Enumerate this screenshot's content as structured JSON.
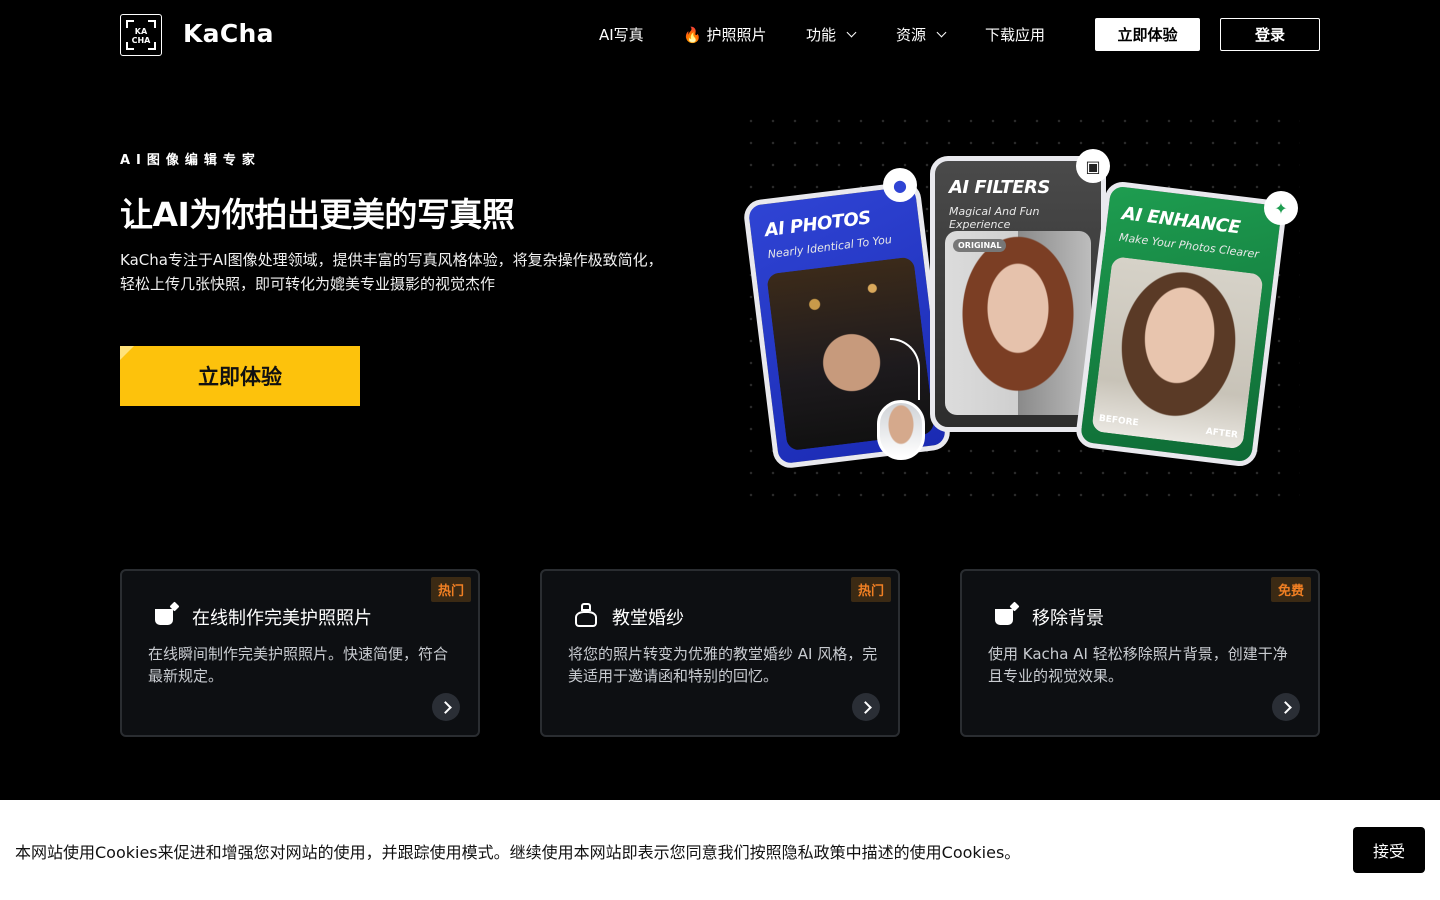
{
  "brand": {
    "logo_mark_line1": "KA",
    "logo_mark_line2": "CHA",
    "name": "KaCha"
  },
  "nav": {
    "items": [
      {
        "label": "AI写真"
      },
      {
        "label": "🔥 护照照片"
      },
      {
        "label": "功能"
      },
      {
        "label": "资源"
      },
      {
        "label": "下载应用"
      }
    ],
    "try_label": "立即体验",
    "login_label": "登录"
  },
  "hero": {
    "eyebrow": "AI图像编辑专家",
    "title": "让AI为你拍出更美的写真照",
    "description": "KaCha专注于AI图像处理领域，提供丰富的写真风格体验，将复杂操作极致简化，轻松上传几张快照，即可转化为媲美专业摄影的视觉杰作",
    "cta_label": "立即体验"
  },
  "illustration": {
    "cards": [
      {
        "title": "AI PHOTOS",
        "subtitle": "Nearly Identical To You",
        "color": "#2f44d4"
      },
      {
        "title": "AI FILTERS",
        "subtitle": "Magical And Fun Experience",
        "tag": "ORIGINAL",
        "color": "#3a3a3a"
      },
      {
        "title": "AI ENHANCE",
        "subtitle": "Make Your Photos Clearer",
        "before": "BEFORE",
        "after": "AFTER",
        "color": "#1e9d50"
      }
    ]
  },
  "features": [
    {
      "badge": "热门",
      "title": "在线制作完美护照照片",
      "description": "在线瞬间制作完美护照照片。快速简便，符合最新规定。",
      "icon": "bag-icon"
    },
    {
      "badge": "热门",
      "title": "教堂婚纱",
      "description": "将您的照片转变为优雅的教堂婚纱 AI 风格，完美适用于邀请函和特别的回忆。",
      "icon": "dress-icon"
    },
    {
      "badge": "免费",
      "title": "移除背景",
      "description": "使用 Kacha AI 轻松移除照片背景，创建干净且专业的视觉效果。",
      "icon": "bag-icon"
    }
  ],
  "cookie": {
    "text": "本网站使用Cookies来促进和增强您对网站的使用，并跟踪使用模式。继续使用本网站即表示您同意我们按照隐私政策中描述的使用Cookies。",
    "accept_label": "接受"
  },
  "colors": {
    "accent_yellow": "#fdc20c",
    "badge_orange": "#f07f23",
    "background": "#000000"
  }
}
